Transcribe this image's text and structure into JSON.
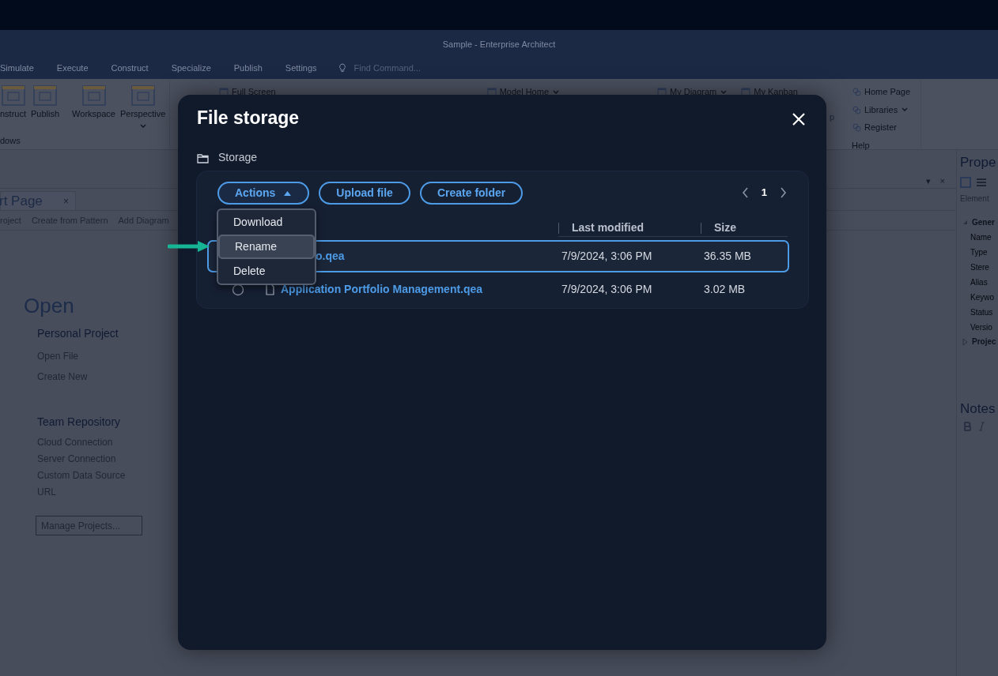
{
  "app": {
    "title": "Sample - Enterprise Architect",
    "menu": [
      "Simulate",
      "Execute",
      "Construct",
      "Specialize",
      "Publish",
      "Settings"
    ],
    "find_placeholder": "Find Command..."
  },
  "ribbon": {
    "large_buttons": [
      {
        "label": "nstruct",
        "dropdown": false
      },
      {
        "label": "Publish",
        "dropdown": false
      },
      {
        "label": "Workspace",
        "dropdown": false
      },
      {
        "label": "Perspective",
        "dropdown": true
      }
    ],
    "group_label": "dows",
    "small_buttons": [
      {
        "label": "Full Screen",
        "dropdown": false
      },
      {
        "label": "Model Home",
        "dropdown": true
      },
      {
        "label": "My Diagram",
        "dropdown": true
      },
      {
        "label": "My Kanban",
        "dropdown": false
      }
    ],
    "help_button": "p",
    "help_items": [
      {
        "label": "Home Page",
        "dropdown": false
      },
      {
        "label": "Libraries",
        "dropdown": true
      },
      {
        "label": "Register",
        "dropdown": false
      }
    ],
    "help_label": "Help"
  },
  "start_page": {
    "tab": "rt Page",
    "tab_close": "×",
    "pane_controls": [
      "▾",
      "×"
    ],
    "toolbar": [
      "roject",
      "Create from Pattern",
      "Add Diagram"
    ],
    "heading": "Open",
    "sections": [
      {
        "title": "Personal Project",
        "links": [
          "Open File",
          "Create New"
        ]
      },
      {
        "title": "Team Repository",
        "links": [
          "Cloud Connection",
          "Server Connection",
          "Custom Data Source",
          "URL"
        ]
      }
    ],
    "manage_button": "Manage Projects..."
  },
  "properties": {
    "title": "Prope",
    "tab": "Element",
    "groups": [
      {
        "label": "Gener",
        "expanded": true,
        "fields": [
          "Name",
          "Type",
          "Stere",
          "Alias",
          "Keywo",
          "Status",
          "Versio"
        ]
      },
      {
        "label": "Projec",
        "expanded": false
      }
    ],
    "notes_title": "Notes"
  },
  "dialog": {
    "title": "File storage",
    "breadcrumb": "Storage",
    "actions": [
      {
        "label": "Actions",
        "kind": "menu",
        "expanded": true
      },
      {
        "label": "Upload file",
        "kind": "button",
        "expanded": false
      },
      {
        "label": "Create folder",
        "kind": "button",
        "expanded": false
      }
    ],
    "page": "1",
    "columns": [
      "Last modified",
      "Size"
    ],
    "rows": [
      {
        "kind": "partial",
        "name": "o.qea",
        "modified": "7/9/2024, 3:06 PM",
        "size": "36.35 MB",
        "selected": true
      },
      {
        "kind": "full",
        "name": "Application Portfolio Management.qea",
        "modified": "7/9/2024, 3:06 PM",
        "size": "3.02 MB",
        "selected": false
      }
    ],
    "menu": [
      {
        "label": "Download",
        "hovered": false
      },
      {
        "label": "Rename",
        "hovered": true
      },
      {
        "label": "Delete",
        "hovered": false
      }
    ]
  }
}
